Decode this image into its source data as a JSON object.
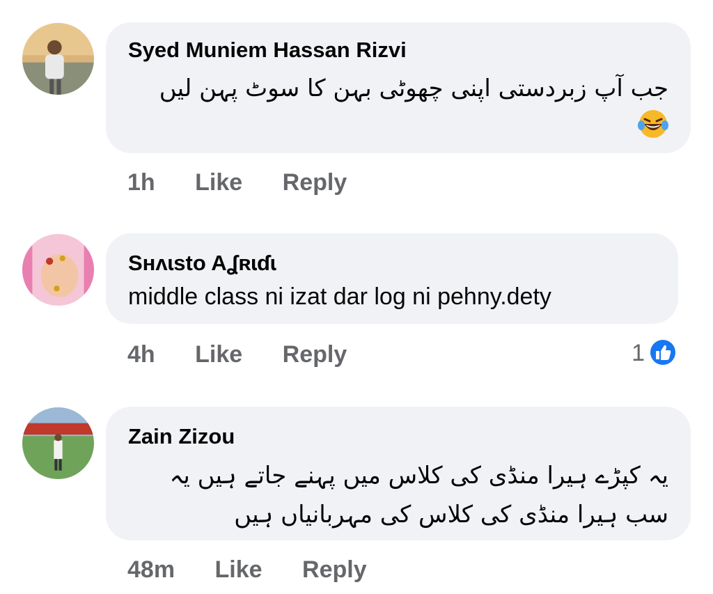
{
  "comments": [
    {
      "author": "Syed Muniem Hassan Rizvi",
      "text": "جب آپ زبردستی اپنی چھوٹی بہن کا سوٹ پہن لیں",
      "time": "1h",
      "like_label": "Like",
      "reply_label": "Reply",
      "emoji": "laughing-tears-emoji"
    },
    {
      "author": "Sʜʌɩsto Aʆʀɩɗɩ",
      "text": "middle class ni izat dar log ni pehny.dety",
      "time": "4h",
      "like_label": "Like",
      "reply_label": "Reply",
      "reaction_count": "1"
    },
    {
      "author": "Zain Zizou",
      "text_line1": "یہ کپڑے ہیرا منڈی کی کلاس میں پہنے جاتے ہیں یہ",
      "text_line2": "سب ہیرا منڈی کی کلاس کی مہربانیاں ہیں",
      "time": "48m",
      "like_label": "Like",
      "reply_label": "Reply"
    }
  ],
  "colors": {
    "bubble": "#f0f2f5",
    "meta": "#65676b",
    "like_blue": "#1877f2"
  }
}
